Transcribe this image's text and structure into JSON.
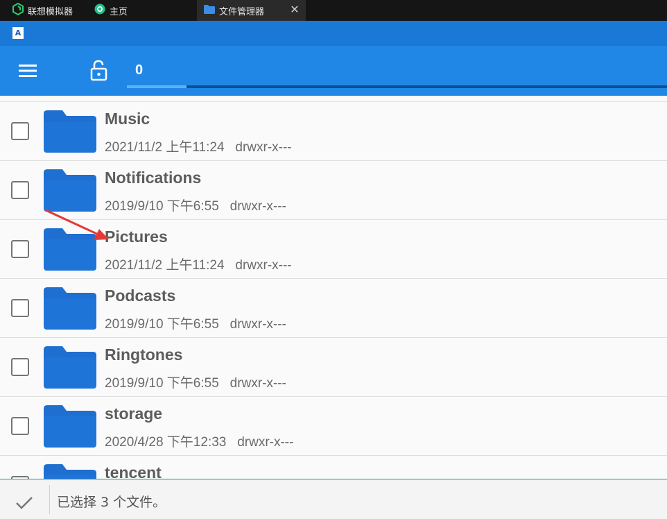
{
  "tabs": [
    {
      "label": "联想模拟器",
      "icon": "emulator-logo-icon"
    },
    {
      "label": "主页",
      "icon": "home-circle-icon"
    },
    {
      "label": "文件管理器",
      "icon": "folder-icon",
      "active": true
    }
  ],
  "app_badge": "A",
  "toolbar": {
    "count": "0",
    "progress": 0.11
  },
  "files": [
    {
      "name": "Music",
      "date": "2021/11/2 上午11:24",
      "perms": "drwxr-x---"
    },
    {
      "name": "Notifications",
      "date": "2019/9/10 下午6:55",
      "perms": "drwxr-x---"
    },
    {
      "name": "Pictures",
      "date": "2021/11/2 上午11:24",
      "perms": "drwxr-x---"
    },
    {
      "name": "Podcasts",
      "date": "2019/9/10 下午6:55",
      "perms": "drwxr-x---"
    },
    {
      "name": "Ringtones",
      "date": "2019/9/10 下午6:55",
      "perms": "drwxr-x---"
    },
    {
      "name": "storage",
      "date": "2020/4/28 下午12:33",
      "perms": "drwxr-x---"
    },
    {
      "name": "tencent",
      "date": "",
      "perms": ""
    }
  ],
  "bottom": {
    "status": "已选择 3 个文件。"
  },
  "colors": {
    "title_strip": "#1a78d6",
    "toolbar": "#2187e6",
    "folder": "#1e6fd0",
    "annotation_arrow": "#e53935"
  }
}
